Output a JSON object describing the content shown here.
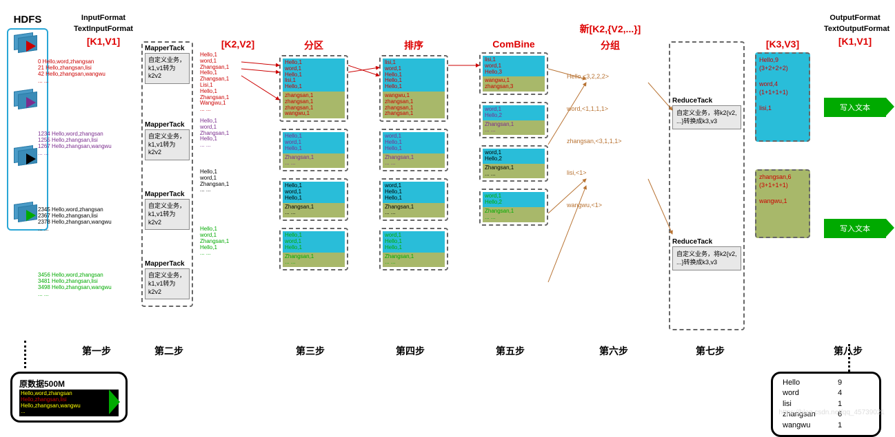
{
  "headers": {
    "hdfs": "HDFS",
    "inputFormat": "InputFormat",
    "textInputFormat": "TextInputFormat",
    "k1v1": "[K1,V1]",
    "k2v2": "[K2,V2]",
    "partition": "分区",
    "sort": "排序",
    "combine": "ComBine",
    "group": "新[K2,{V2,...}]",
    "groupSub": "分组",
    "k3v3": "[K3,V3]",
    "outputFormat": "OutputFormat",
    "textOutputFormat": "TextOutputFormat",
    "k1v1out": "[K1,V1]"
  },
  "mapperLabel": "MapperTack",
  "mapperBody": "自定义业务，k1,v1转为k2v2",
  "reduceLabel": "ReduceTack",
  "reduceBody1": "自定义业务，将k2{v2, ...}转换成k3,v3",
  "reduceBody2": "自定义业务，将k2{v2, ...}转换成k3,v3",
  "writeLabel": "写入文本",
  "inputLines": {
    "red": [
      "0  Hello,word,zhangsan",
      "21  Hello,zhangsan,lisi",
      "42  Hello,zhangsan,wangwu",
      "... ..."
    ],
    "purple": [
      "1234  Hello,word,zhangsan",
      "1255  Hello,zhangsan,lisi",
      "1267  Hello,zhangsan,wangwu",
      "... ..."
    ],
    "black": [
      "2345  Hello,word,zhangsan",
      "2367  Hello,zhangsan,lisi",
      "2378  Hello,zhangsan,wangwu",
      "... ..."
    ],
    "green": [
      "3456  Hello,word,zhangsan",
      "3481  Hello,zhangsan,lisi",
      "3498  Hello,zhangsan,wangwu",
      "... ..."
    ]
  },
  "kv2": {
    "red": [
      "Hello,1",
      "word,1",
      "Zhangsan,1",
      "Hello,1",
      "Zhangsan,1",
      "Lisi,1",
      "Hello,1",
      "Zhangsan,1",
      "Wangwu,1",
      "... ..."
    ],
    "purple": [
      "Hello,1",
      "word,1",
      "Zhangsan,1",
      "Hello,1",
      "... ..."
    ],
    "black": [
      "Hello,1",
      "word,1",
      "Zhangsan,1",
      "... ..."
    ],
    "green": [
      "Hello,1",
      "word,1",
      "Zhangsan,1",
      "Hello,1",
      "... ..."
    ]
  },
  "partitionBoxes": [
    {
      "top": [
        "Hello,1",
        "word,1",
        "Hello,1",
        "lisi,1",
        "Hello,1"
      ],
      "bot": [
        "zhangsan,1",
        "zhangsan,1",
        "zhangsan,1",
        "wangwu,1"
      ]
    },
    {
      "top": [
        "Hello,1",
        "word,1",
        "Hello,1"
      ],
      "bot": [
        "Zhangsan,1",
        "... ..."
      ]
    },
    {
      "top": [
        "Hello,1",
        "word,1",
        "Hello,1"
      ],
      "bot": [
        "Zhangsan,1",
        "... ..."
      ]
    },
    {
      "top": [
        "Hello,1",
        "word,1",
        "Hello,1"
      ],
      "bot": [
        "Zhangsan,1",
        "... ..."
      ]
    }
  ],
  "sortBoxes": [
    {
      "top": [
        "lisi,1",
        "word,1",
        "Hello,1",
        "Hello,1",
        "Hello,1"
      ],
      "bot": [
        "wangwu,1",
        "zhangsan,1",
        "zhangsan,1",
        "zhangsan,1"
      ]
    },
    {
      "top": [
        "word,1",
        "Hello,1",
        "Hello,1"
      ],
      "bot": [
        "Zhangsan,1",
        "... ..."
      ]
    },
    {
      "top": [
        "word,1",
        "Hello,1",
        "Hello,1"
      ],
      "bot": [
        "Zhangsan,1",
        "... ..."
      ]
    },
    {
      "top": [
        "word,1",
        "Hello,1",
        "Hello,1"
      ],
      "bot": [
        "Zhangsan,1",
        "... ..."
      ]
    }
  ],
  "combineBoxes": [
    {
      "top": [
        "lisi,1",
        "word,1",
        "Hello,3"
      ],
      "bot": [
        "wangwu,1",
        "zhangsan,3"
      ]
    },
    {
      "top": [
        "word,1",
        "Hello,2"
      ],
      "bot": [
        "Zhangsan,1",
        "... ..."
      ]
    },
    {
      "top": [
        "word,1",
        "Hello,2"
      ],
      "bot": [
        "Zhangsan,1",
        "... ..."
      ]
    },
    {
      "top": [
        "word,1",
        "Hello,2"
      ],
      "bot": [
        "Zhangsan,1",
        "... ..."
      ]
    }
  ],
  "shuffle": [
    "Hello,<3,2,2,2>",
    "word,<1,1,1,1>",
    "zhangsan,<3,1,1,1>",
    "lisi,<1>",
    "wangwu,<1>"
  ],
  "output1": [
    "Hello,9",
    "(3+2+2+2)",
    "",
    "word,4",
    "(1+1+1+1)",
    "",
    "lisi,1"
  ],
  "output2": [
    "zhangsan,6",
    "(3+1+1+1)",
    "",
    "wangwu,1"
  ],
  "steps": [
    "第一步",
    "第二步",
    "第三步",
    "第四步",
    "第五步",
    "第六步",
    "第七步",
    "第八步"
  ],
  "source": {
    "title": "原数据500M",
    "rows": [
      "Hello,word,zhangsan",
      "Hello,zhangsan,lisi",
      "Hello,zhangsan,wangwu",
      "..."
    ]
  },
  "result": [
    [
      "Hello",
      "9"
    ],
    [
      "word",
      "4"
    ],
    [
      "lisi",
      "1"
    ],
    [
      "zhangsan",
      "6"
    ],
    [
      "wangwu",
      "1"
    ]
  ],
  "watermark": "https://blog.csdn.net/qq_45739021"
}
